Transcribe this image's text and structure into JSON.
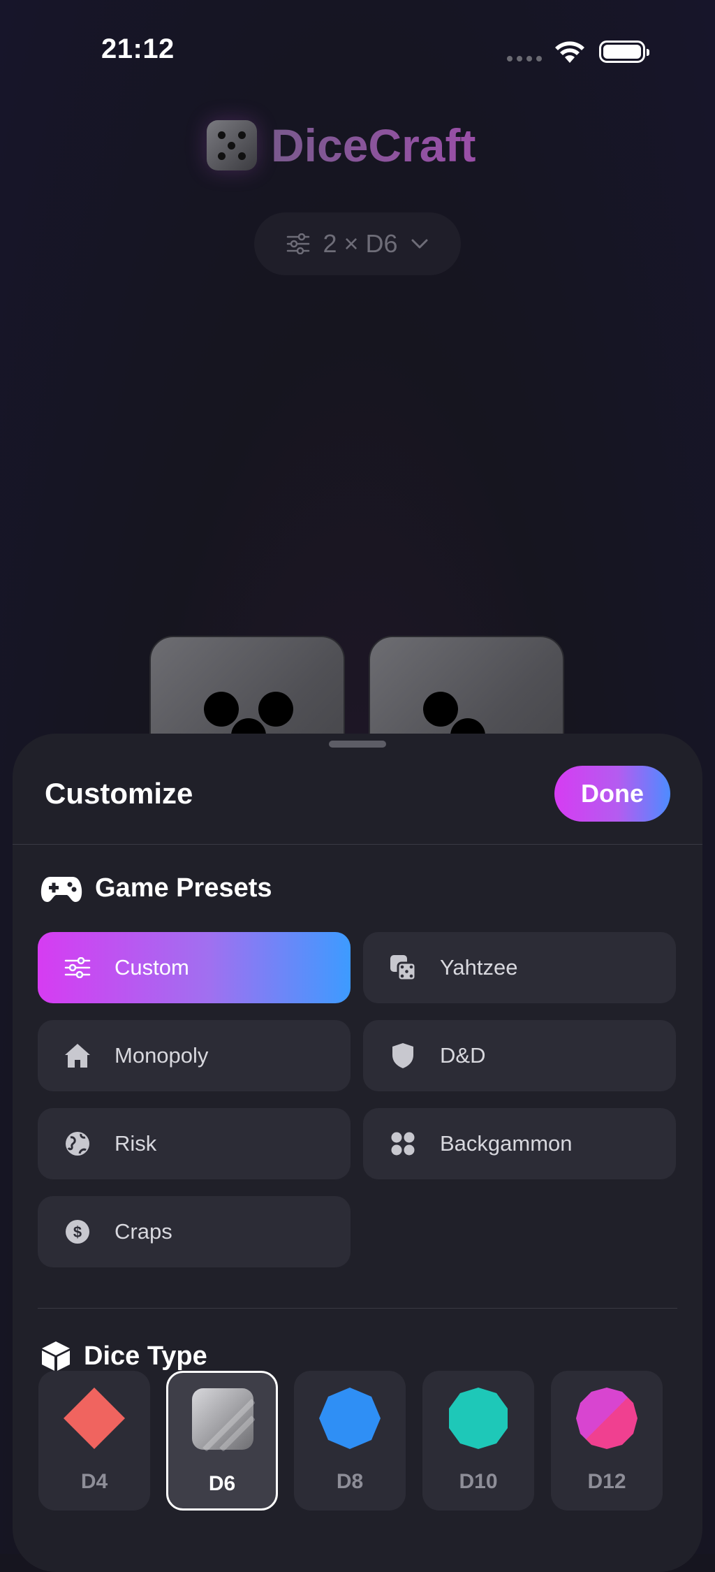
{
  "status": {
    "time": "21:12"
  },
  "app": {
    "title": "DiceCraft",
    "dice_count_label": "2 × D6"
  },
  "sheet": {
    "title": "Customize",
    "done_label": "Done",
    "presets_header": "Game Presets",
    "presets": [
      {
        "label": "Custom",
        "icon": "sliders-icon",
        "selected": true
      },
      {
        "label": "Yahtzee",
        "icon": "dice-icon",
        "selected": false
      },
      {
        "label": "Monopoly",
        "icon": "house-icon",
        "selected": false
      },
      {
        "label": "D&D",
        "icon": "shield-icon",
        "selected": false
      },
      {
        "label": "Risk",
        "icon": "globe-icon",
        "selected": false
      },
      {
        "label": "Backgammon",
        "icon": "four-circles-icon",
        "selected": false
      },
      {
        "label": "Craps",
        "icon": "dollar-icon",
        "selected": false
      }
    ],
    "dice_type_header": "Dice Type",
    "dice_types": [
      {
        "label": "D4",
        "color": "#f0645f",
        "selected": false
      },
      {
        "label": "D6",
        "color": "#b8b8bc",
        "selected": true
      },
      {
        "label": "D8",
        "color": "#2f8ff5",
        "selected": false
      },
      {
        "label": "D10",
        "color": "#1ec8b8",
        "selected": false
      },
      {
        "label": "D12",
        "color": "#e6409a",
        "selected": false
      }
    ]
  },
  "colors": {
    "accent_start": "#d63cf2",
    "accent_end": "#3d9bff",
    "background": "#16151f",
    "sheet": "#202029",
    "card": "#2c2c36"
  }
}
